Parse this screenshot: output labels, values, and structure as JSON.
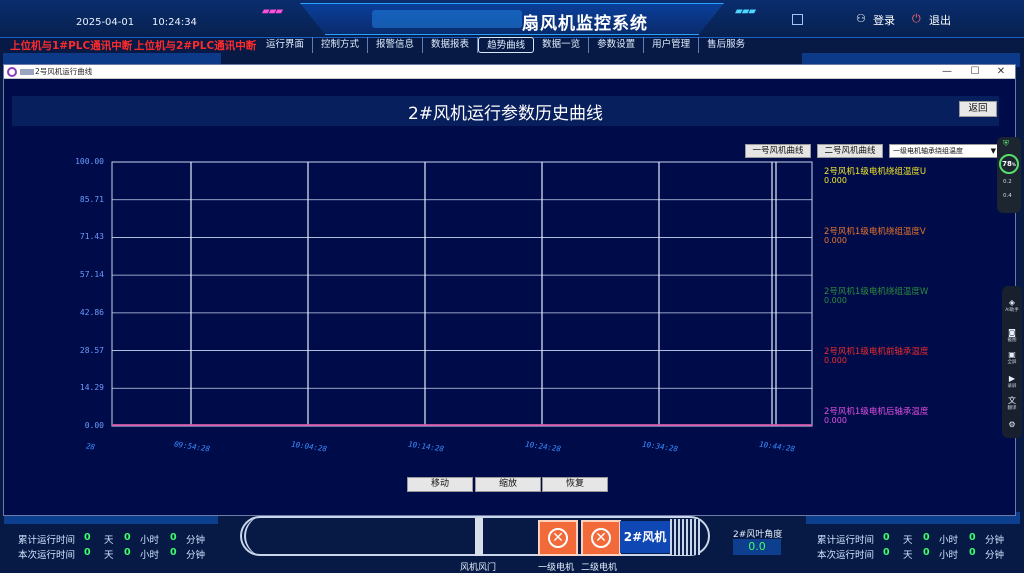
{
  "header": {
    "date": "2025-04-01",
    "time": "10:24:34",
    "title": "扇风机监控系统",
    "login_label": "登录",
    "logout_label": "退出"
  },
  "alarms": [
    "上位机与1#PLC通讯中断",
    "上位机与2#PLC通讯中断"
  ],
  "nav": {
    "items": [
      "运行界面",
      "控制方式",
      "报警信息",
      "数据报表",
      "趋势曲线",
      "数据一览",
      "参数设置",
      "用户管理",
      "售后服务"
    ],
    "active_index": 4
  },
  "window": {
    "title": "2号风机运行曲线",
    "minimize": "—",
    "maximize": "☐",
    "close": "✕"
  },
  "chart_header": {
    "title": "2#风机运行参数历史曲线",
    "back_label": "返回"
  },
  "selectors": {
    "fan1_label": "一号风机曲线",
    "fan2_label": "二号风机曲线",
    "dropdown_value": "一级电机轴承绕组温度"
  },
  "controls": {
    "move_label": "移动",
    "zoom_label": "缩放",
    "restore_label": "恢复"
  },
  "chart_data": {
    "type": "line",
    "title": "2#风机运行参数历史曲线",
    "ylim": [
      0,
      100
    ],
    "y_ticks": [
      "100.00",
      "85.71",
      "71.43",
      "57.14",
      "42.86",
      "28.57",
      "14.29",
      "0.00"
    ],
    "x_ticks": [
      "28",
      "09:54:28",
      "10:04:28",
      "10:14:28",
      "10:24:28",
      "10:34:28",
      "10:44:28"
    ],
    "grid": true,
    "legend_position": "right",
    "series": [
      {
        "name": "2号风机1级电机绕组温度U",
        "value": "0.000",
        "color": "#f2e629",
        "values": [
          0,
          0,
          0,
          0,
          0,
          0,
          0
        ]
      },
      {
        "name": "2号风机1级电机绕组温度V",
        "value": "0.000",
        "color": "#e8742a",
        "values": [
          0,
          0,
          0,
          0,
          0,
          0,
          0
        ]
      },
      {
        "name": "2号风机1级电机绕组温度W",
        "value": "0.000",
        "color": "#2d8a3a",
        "values": [
          0,
          0,
          0,
          0,
          0,
          0,
          0
        ]
      },
      {
        "name": "2号风机1级电机前轴承温度",
        "value": "0.000",
        "color": "#ee2a2a",
        "values": [
          0,
          0,
          0,
          0,
          0,
          0,
          0
        ]
      },
      {
        "name": "2号风机1级电机后轴承温度",
        "value": "0.000",
        "color": "#e14fe0",
        "values": [
          0,
          0,
          0,
          0,
          0,
          0,
          0
        ]
      }
    ]
  },
  "stats_left": {
    "rows": [
      {
        "label": "累计运行时间",
        "days": "0",
        "hours": "0",
        "minutes": "0"
      },
      {
        "label": "本次运行时间",
        "days": "0",
        "hours": "0",
        "minutes": "0"
      }
    ],
    "day_unit": "天",
    "hour_unit": "小时",
    "minute_unit": "分钟"
  },
  "stats_right": {
    "rows": [
      {
        "label": "累计运行时间",
        "days": "0",
        "hours": "0",
        "minutes": "0"
      },
      {
        "label": "本次运行时间",
        "days": "0",
        "hours": "0",
        "minutes": "0"
      }
    ],
    "day_unit": "天",
    "hour_unit": "小时",
    "minute_unit": "分钟"
  },
  "bottom_scene": {
    "fan_label": "2#风机",
    "angle_label": "2#风叶角度",
    "angle_value": "0.0",
    "gate_label": "风机风门",
    "motor1_label": "一级电机",
    "motor2_label": "二级电机"
  },
  "widgets": {
    "gauge_value": "78",
    "gauge_unit": "%",
    "speed1": "0.2",
    "speed2": "0.4",
    "tools": [
      "AI助手",
      "截图",
      "全屏",
      "录屏",
      "翻译",
      "设置"
    ]
  },
  "colors": {
    "background": "#061a45",
    "chart_bg": "#000c4a",
    "alarm": "#ff2a2a",
    "counter": "#3dff6a"
  }
}
